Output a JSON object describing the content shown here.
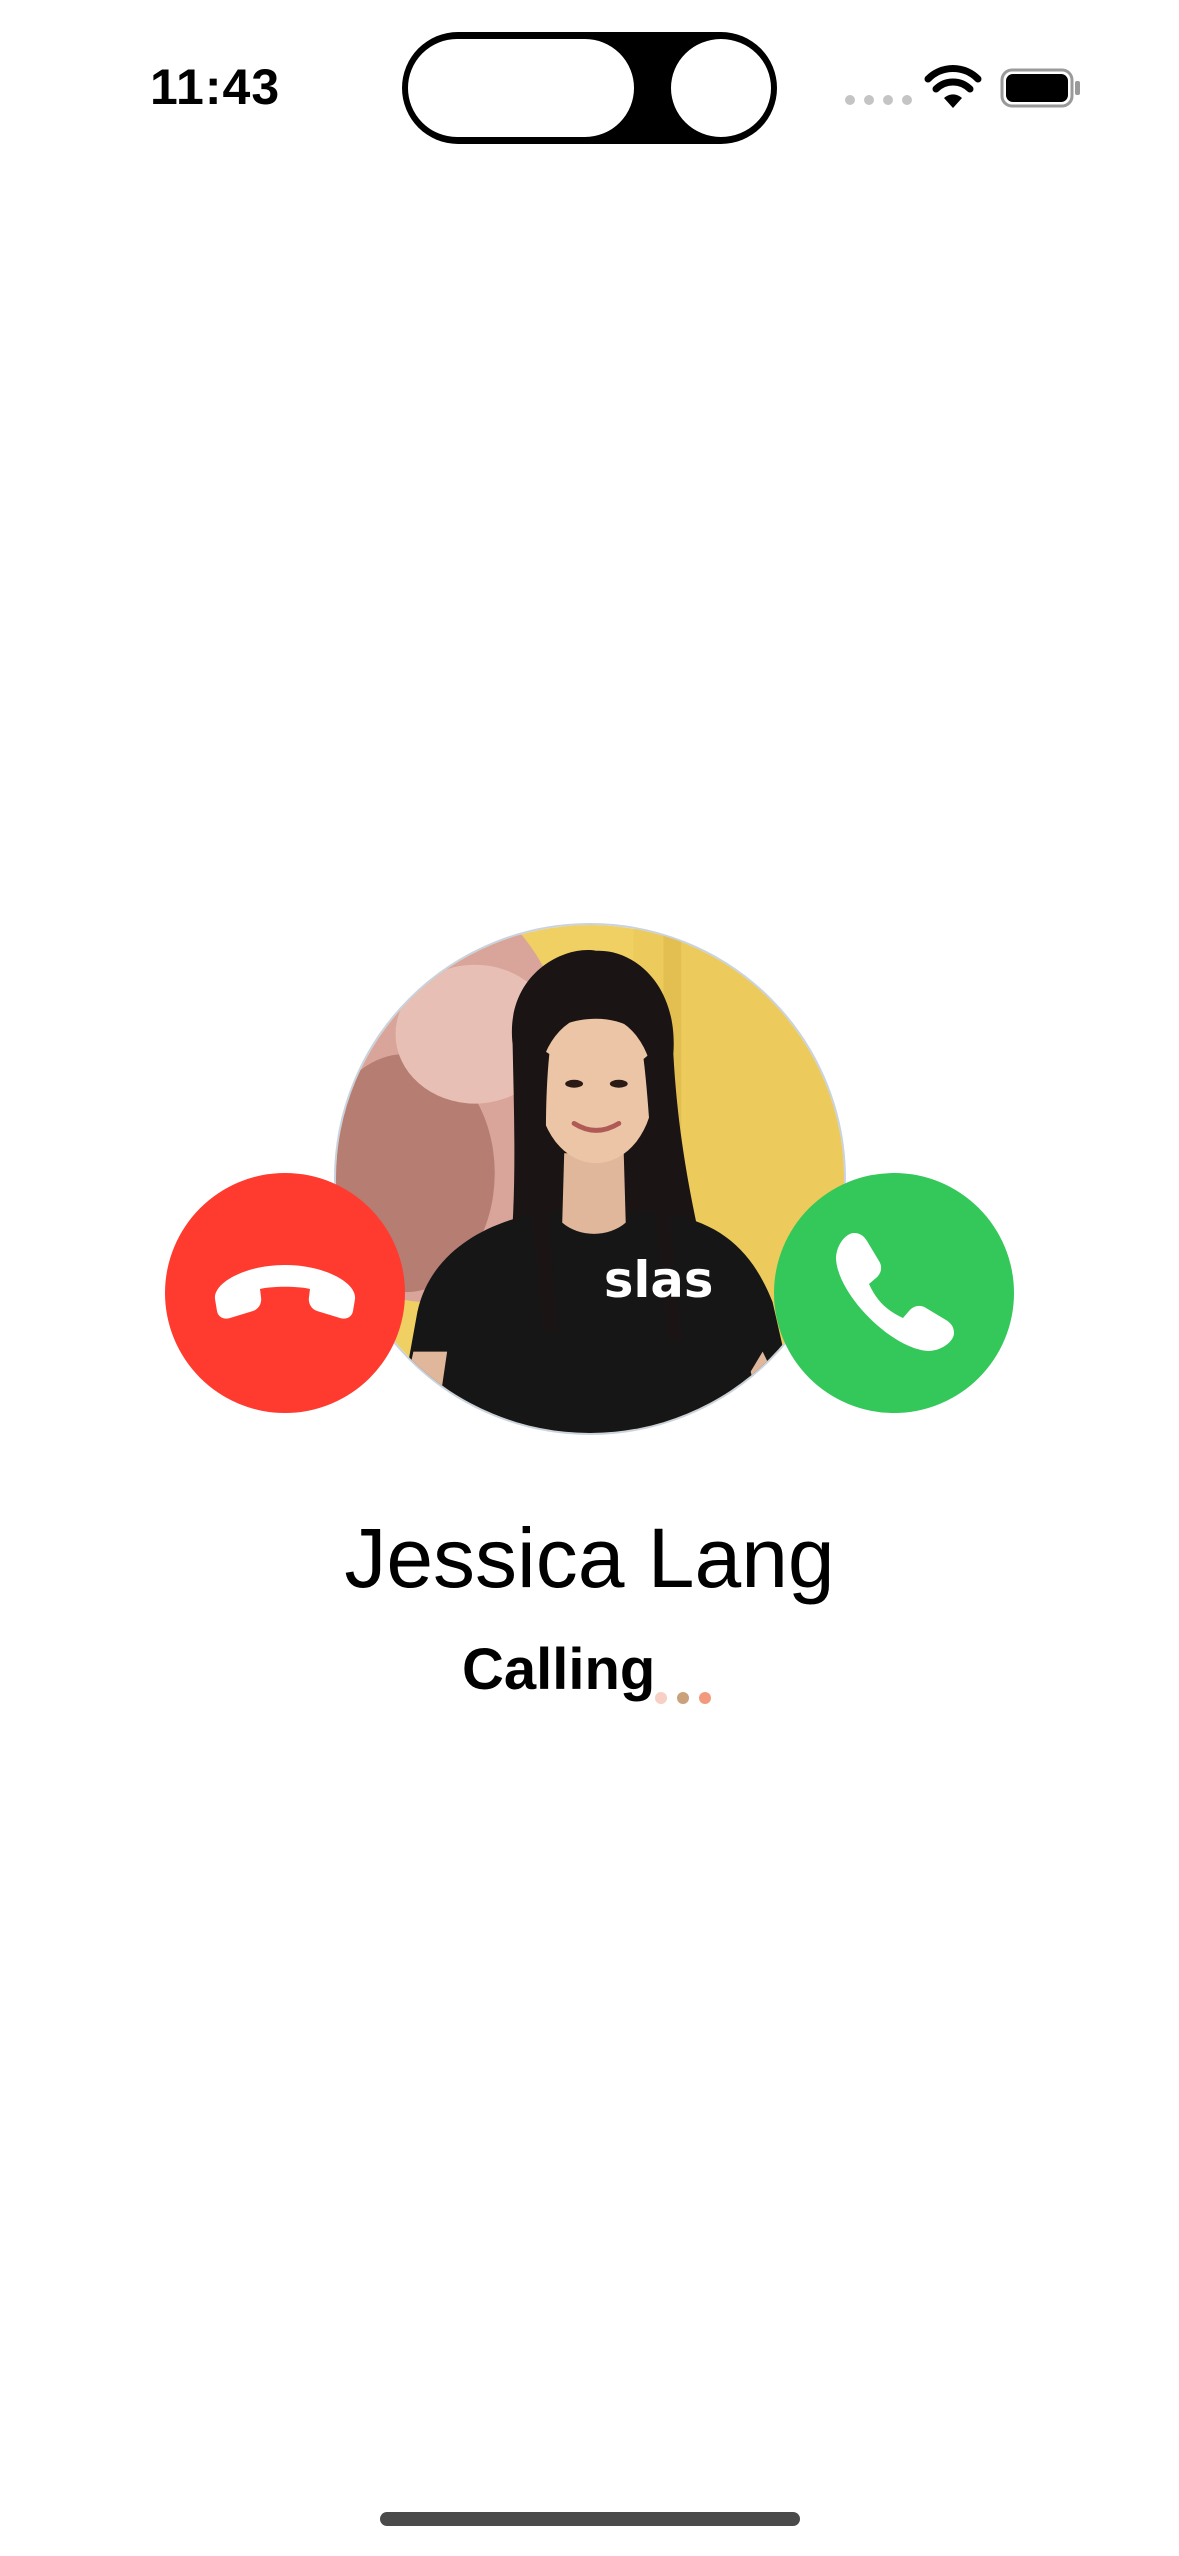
{
  "status_bar": {
    "time": "11:43"
  },
  "call": {
    "caller_name": "Jessica Lang",
    "status": "Calling",
    "shirt_text": "slas",
    "decline_color": "#ff3b30",
    "accept_color": "#34c759",
    "dot_colors": [
      "#f6d0c4",
      "#c9a27c",
      "#f29a7e"
    ]
  },
  "icons": {
    "decline": "phone-down-icon",
    "accept": "phone-icon",
    "wifi": "wifi-icon",
    "battery": "battery-icon"
  }
}
